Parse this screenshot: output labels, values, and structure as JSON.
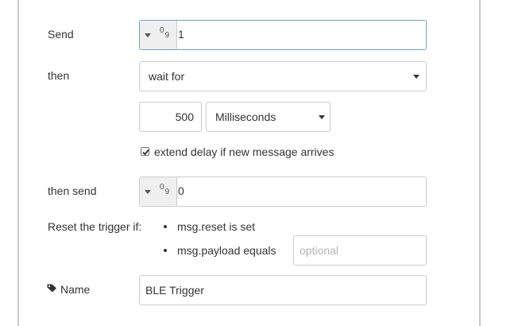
{
  "form": {
    "send": {
      "label": "Send",
      "value": "1"
    },
    "then": {
      "label": "then",
      "mode": "wait for"
    },
    "duration": {
      "value": "500",
      "units": "Milliseconds"
    },
    "extend": {
      "checked": true,
      "label": "extend delay if new message arrives"
    },
    "then_send": {
      "label": "then send",
      "value": "0"
    },
    "reset": {
      "label": "Reset the trigger if:",
      "options": [
        "msg.reset is set",
        "msg.payload equals"
      ],
      "payload_placeholder": "optional"
    },
    "name": {
      "label": "Name",
      "value": "BLE Trigger"
    }
  },
  "icons": {
    "tag": "tag-icon",
    "type_menu": "chevron-down-icon",
    "number_type": "number-type-icon"
  },
  "colors": {
    "focus_border": "#6e9fd6",
    "border": "#cccccc",
    "type_button_bg": "#efefef"
  }
}
